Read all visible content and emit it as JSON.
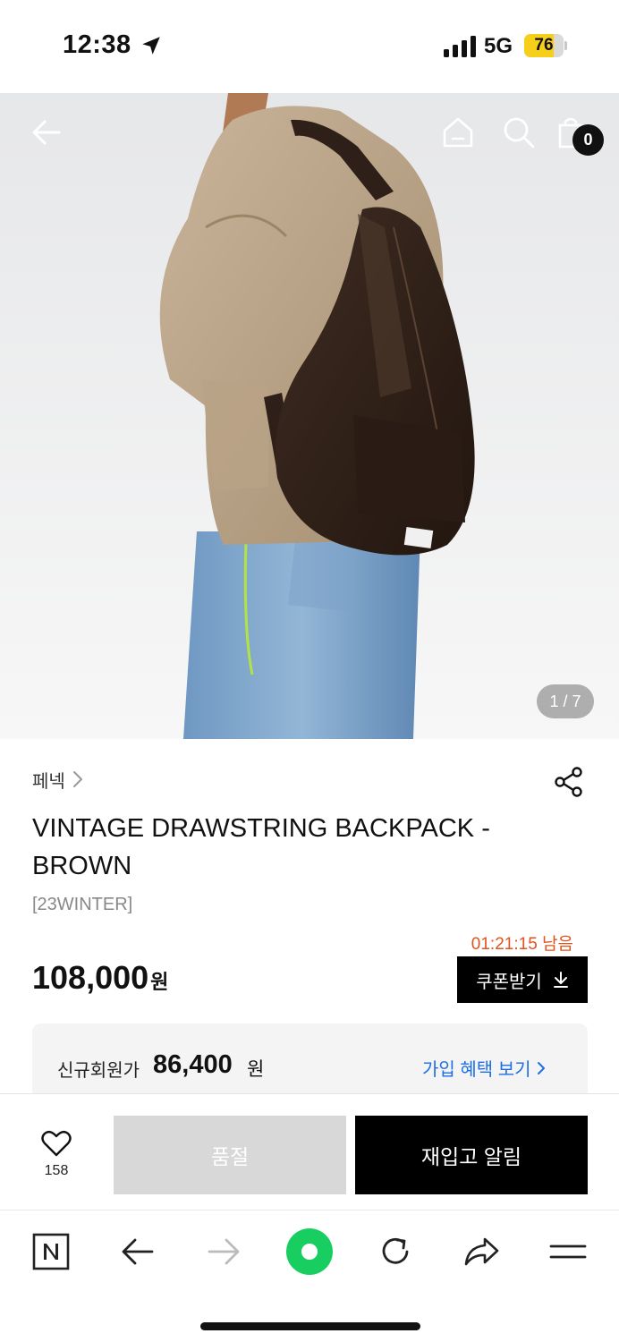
{
  "status_bar": {
    "time": "12:38",
    "network": "5G",
    "battery_percent": 76,
    "battery_label": "76"
  },
  "hero": {
    "page_indicator": "1 / 7",
    "cart_count": "0",
    "icons": [
      "back-arrow-icon",
      "home-icon",
      "search-icon",
      "shopping-bag-icon"
    ]
  },
  "product": {
    "brand": "페넥",
    "title": "VINTAGE DRAWSTRING BACKPACK - BROWN",
    "tag": "[23WINTER]",
    "timer": "01:21:15 남음",
    "price": "108,000",
    "price_unit": "원",
    "coupon_label": "쿠폰받기"
  },
  "member": {
    "label": "신규회원가",
    "price": "86,400",
    "unit": "원",
    "link_label": "가입 혜택 보기"
  },
  "purchase": {
    "like_count": "158",
    "soldout_label": "품절",
    "restock_label": "재입고 알림"
  },
  "browser": {
    "icons": [
      "naver-n-icon",
      "back-icon",
      "forward-icon",
      "green-dot-icon",
      "refresh-icon",
      "share-icon",
      "menu-icon"
    ]
  },
  "colors": {
    "accent_timer": "#e0531d",
    "link_blue": "#1f6fe0",
    "battery_yellow": "#f6cf1a",
    "naver_green": "#19ce60"
  }
}
